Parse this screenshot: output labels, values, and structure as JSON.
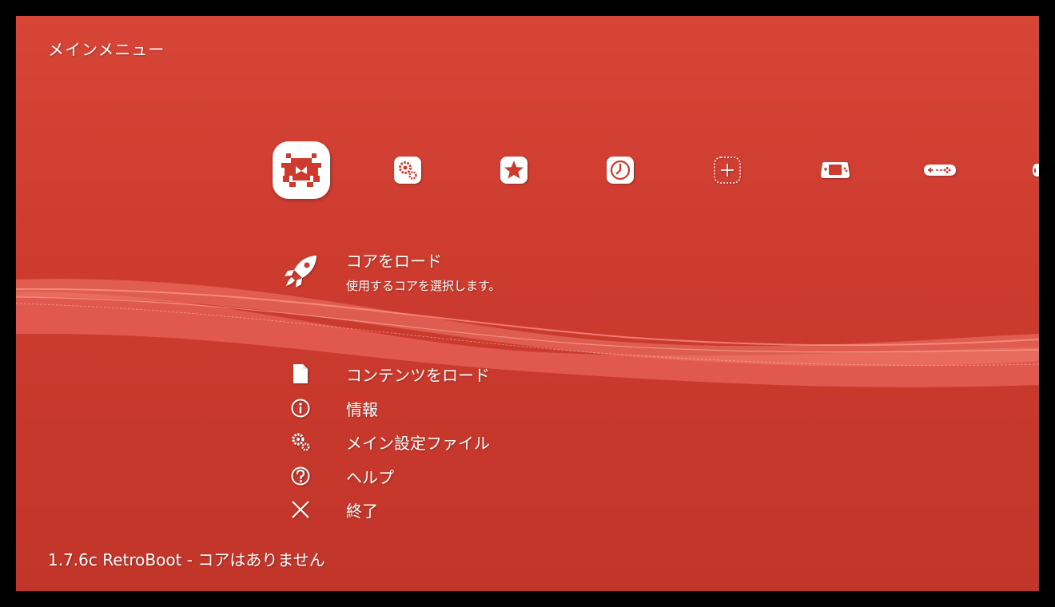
{
  "header": {
    "title": "メインメニュー"
  },
  "tabs": [
    {
      "name": "main-menu",
      "icon": "retroarch-invader-icon"
    },
    {
      "name": "settings",
      "icon": "settings-gears-icon"
    },
    {
      "name": "favorites",
      "icon": "star-icon"
    },
    {
      "name": "history",
      "icon": "clock-icon"
    },
    {
      "name": "add",
      "icon": "plus-icon"
    },
    {
      "name": "gba",
      "icon": "handheld-console-icon"
    },
    {
      "name": "snes",
      "icon": "gamepad-icon"
    },
    {
      "name": "more",
      "icon": "gamepad-partial-icon"
    }
  ],
  "selected": {
    "label": "コアをロード",
    "sublabel": "使用するコアを選択します。",
    "icon": "rocket-icon"
  },
  "menu": [
    {
      "label": "コンテンツをロード",
      "icon": "file-icon"
    },
    {
      "label": "情報",
      "icon": "info-icon"
    },
    {
      "label": "メイン設定ファイル",
      "icon": "settings-gears-icon"
    },
    {
      "label": "ヘルプ",
      "icon": "help-icon"
    },
    {
      "label": "終了",
      "icon": "close-icon"
    }
  ],
  "footer": {
    "status": "1.7.6c RetroBoot - コアはありません"
  },
  "colors": {
    "background": "#cc3b2e",
    "ribbon": "#f0766a",
    "foreground": "#ffffff"
  }
}
